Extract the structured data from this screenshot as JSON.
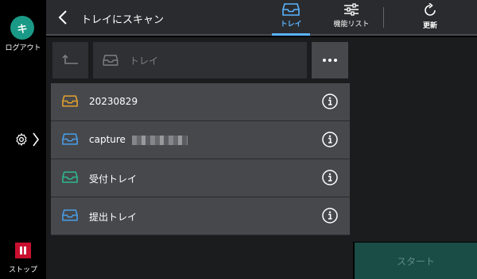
{
  "rail": {
    "logout_glyph": "キ",
    "logout_label": "ログアウト",
    "stop_label": "ストップ"
  },
  "header": {
    "title": "トレイにスキャン",
    "tabs": [
      {
        "label": "トレイ",
        "icon": "tray-icon",
        "active": true
      },
      {
        "label": "機能リスト",
        "icon": "sliders-icon",
        "active": false
      },
      {
        "label": "更新",
        "icon": "refresh-icon",
        "active": false
      }
    ]
  },
  "path": {
    "text": "トレイ",
    "icon": "tray-icon"
  },
  "items": [
    {
      "name": "20230829",
      "icon": "tray-icon",
      "color": "#e3a12f",
      "redacted": false
    },
    {
      "name": "capture",
      "icon": "tray-icon",
      "color": "#4a9ee8",
      "redacted": true
    },
    {
      "name": "受付トレイ",
      "icon": "tray-icon",
      "color": "#2dba8a",
      "redacted": false
    },
    {
      "name": "提出トレイ",
      "icon": "tray-icon",
      "color": "#4a9ee8",
      "redacted": false
    }
  ],
  "start_label": "スタート",
  "colors": {
    "accent": "#5ab4ff",
    "logout": "#1a9a86",
    "stop": "#c8102e",
    "start_disabled": "#1a4d45"
  }
}
